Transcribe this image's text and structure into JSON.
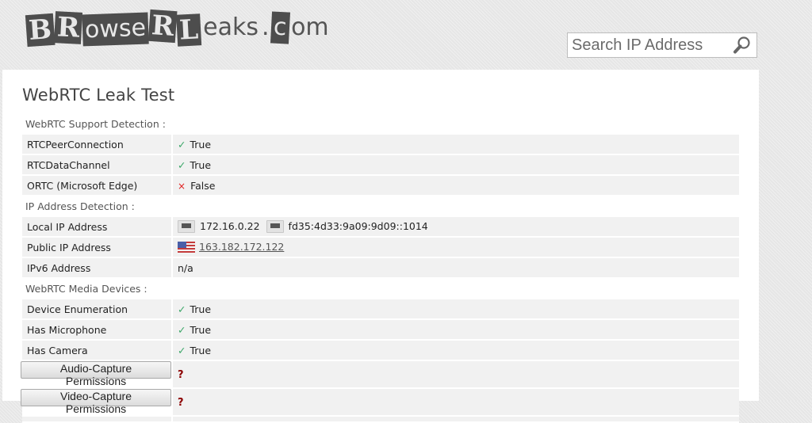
{
  "site": {
    "logo_text": "BRowseRLeaks.com",
    "logo_parts": [
      "B",
      "R",
      "owse",
      "R",
      "L",
      "eaks",
      ".",
      "c",
      "om"
    ]
  },
  "search": {
    "placeholder": "Search IP Address",
    "icon": "magnifier-icon"
  },
  "page": {
    "title": "WebRTC Leak Test"
  },
  "sections": [
    {
      "label": "WebRTC Support Detection :",
      "rows": [
        {
          "key": "RTCPeerConnection",
          "status_icon": "check-icon",
          "symbol": "✓",
          "value": "True"
        },
        {
          "key": "RTCDataChannel",
          "status_icon": "check-icon",
          "symbol": "✓",
          "value": "True"
        },
        {
          "key": "ORTC (Microsoft Edge)",
          "status_icon": "cross-icon",
          "symbol": "×",
          "value": "False"
        }
      ]
    },
    {
      "label": "IP Address Detection :",
      "rows": [
        {
          "key": "Local IP Address",
          "values": [
            {
              "icon": "network-icon",
              "text": "172.16.0.22"
            },
            {
              "icon": "network-icon",
              "text": "fd35:4d33:9a09:9d09::1014"
            }
          ]
        },
        {
          "key": "Public IP Address",
          "icon": "us-flag-icon",
          "value": "163.182.172.122"
        },
        {
          "key": "IPv6 Address",
          "value": "n/a"
        }
      ]
    },
    {
      "label": "WebRTC Media Devices :",
      "rows": [
        {
          "key": "Device Enumeration",
          "status_icon": "check-icon",
          "symbol": "✓",
          "value": "True"
        },
        {
          "key": "Has Microphone",
          "status_icon": "check-icon",
          "symbol": "✓",
          "value": "True"
        },
        {
          "key": "Has Camera",
          "status_icon": "check-icon",
          "symbol": "✓",
          "value": "True"
        }
      ],
      "buttons": [
        {
          "label": "Audio-Capture Permissions",
          "value": "?"
        },
        {
          "label": "Video-Capture Permissions",
          "value": "?"
        }
      ]
    }
  ],
  "colors": {
    "check": "#3aa667",
    "cross": "#e02020",
    "unknown": "#8b0000"
  }
}
